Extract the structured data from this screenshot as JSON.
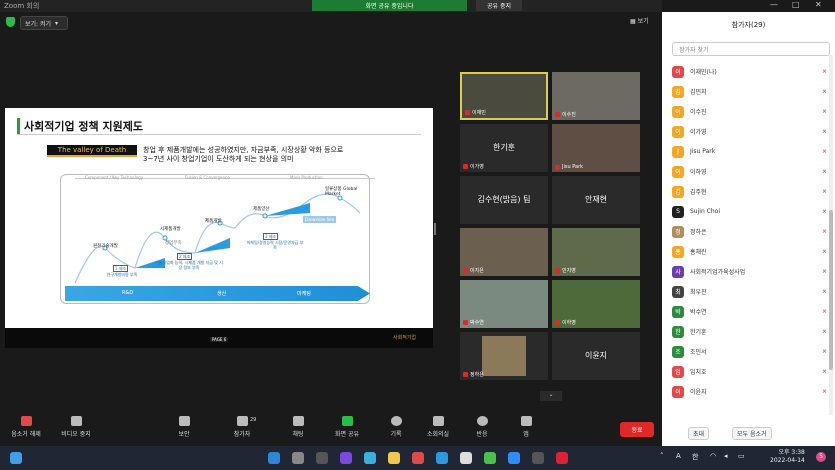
{
  "window": {
    "title": "Zoom 회의",
    "share_banner": "화면 공유 중입니다",
    "stop_share": "공유 중지",
    "controls": [
      "—",
      "□",
      "✕"
    ]
  },
  "top": {
    "view_label": "보기: 켜기",
    "gallery_label": "보기"
  },
  "slide": {
    "title": "사회적기업 정책 지원제도",
    "tag": "The valley of Death",
    "desc_line1": "창업 후 제품개발에는 성공하였지만, 자금부족, 시장상황 악화 등으로",
    "desc_line2": "3~7년 사이 창업기업이 도산하게 되는 현상을 의미",
    "phases": [
      "Component / Key Technology",
      "Fusion & Convergence",
      "Mass Production"
    ],
    "bars": [
      "R&D",
      "생산",
      "마케팅"
    ],
    "points": [
      "원천기술개발",
      "시제품개발",
      "제품개발",
      "제품양산",
      "일류상품 Global Market"
    ],
    "stages": [
      {
        "label": "1 제조",
        "note": "연구개발비용 부족"
      },
      {
        "label": "2 제조",
        "note": "기술사업화 능력, 시제품 개발 자금 및 시장 정보 부족"
      },
      {
        "label": "3 제조",
        "note": "마케팅/경영능력 시장/운영자금 부족"
      }
    ],
    "small_labels": [
      "Death Valley",
      "Darwinian Sea",
      "창업부족"
    ],
    "page": "PAGE 6",
    "logo": "사회적기업"
  },
  "video_tiles": [
    {
      "name": "이재민",
      "big": ""
    },
    {
      "name": "이수진",
      "big": ""
    },
    {
      "name": "이가영",
      "big": "한기훈"
    },
    {
      "name": "Jisu Park",
      "big": ""
    },
    {
      "name": "",
      "big": "김수현(밝음) 팀"
    },
    {
      "name": "",
      "big": "안재현"
    },
    {
      "name": "이지은",
      "big": ""
    },
    {
      "name": "민지영",
      "big": ""
    },
    {
      "name": "박수연",
      "big": ""
    },
    {
      "name": "이하영",
      "big": ""
    },
    {
      "name": "정하은",
      "big": ""
    },
    {
      "name": "",
      "big": "이윤지"
    }
  ],
  "more_label": "⌄",
  "toolbar": {
    "items": [
      "음소거 해제",
      "비디오 중지",
      "보안",
      "참가자",
      "채팅",
      "화면 공유",
      "기록",
      "소회의실",
      "반응",
      "앱"
    ],
    "participant_count": "29",
    "end": "종료"
  },
  "panel": {
    "title": "참가자(29)",
    "search": "참가자 찾기",
    "participants": [
      {
        "initial": "이",
        "name": "이재민(나)",
        "color": "#e04a4a"
      },
      {
        "initial": "김",
        "name": "김민지",
        "color": "#f5a623"
      },
      {
        "initial": "이",
        "name": "이수진",
        "color": "#f5a623"
      },
      {
        "initial": "이",
        "name": "이가영",
        "color": "#f5a623"
      },
      {
        "initial": "J",
        "name": "Jisu Park",
        "color": "#f5a623"
      },
      {
        "initial": "이",
        "name": "이하영",
        "color": "#f5a623"
      },
      {
        "initial": "김",
        "name": "김주현",
        "color": "#f5a623"
      },
      {
        "initial": "S",
        "name": "Sujin Choi",
        "color": "#222222"
      },
      {
        "initial": "정",
        "name": "정하은",
        "color": "#b08e5a"
      },
      {
        "initial": "홍",
        "name": "홍채린",
        "color": "#f5a623"
      },
      {
        "initial": "사",
        "name": "사회적기업가육성사업",
        "color": "#6a3db0"
      },
      {
        "initial": "최",
        "name": "최우진",
        "color": "#444444"
      },
      {
        "initial": "박",
        "name": "박수연",
        "color": "#2e8b3e"
      },
      {
        "initial": "한",
        "name": "한기훈",
        "color": "#2e8b3e"
      },
      {
        "initial": "조",
        "name": "조민서",
        "color": "#2e8b3e"
      },
      {
        "initial": "임",
        "name": "임지호",
        "color": "#e04a4a"
      },
      {
        "initial": "이",
        "name": "이윤지",
        "color": "#e04a4a"
      }
    ],
    "btn_invite": "초대",
    "btn_mute_all": "모두 음소거"
  },
  "taskbar": {
    "time": "오후 3:38",
    "date": "2022-04-14",
    "lang": "A",
    "ime": "한",
    "badge": "5"
  }
}
